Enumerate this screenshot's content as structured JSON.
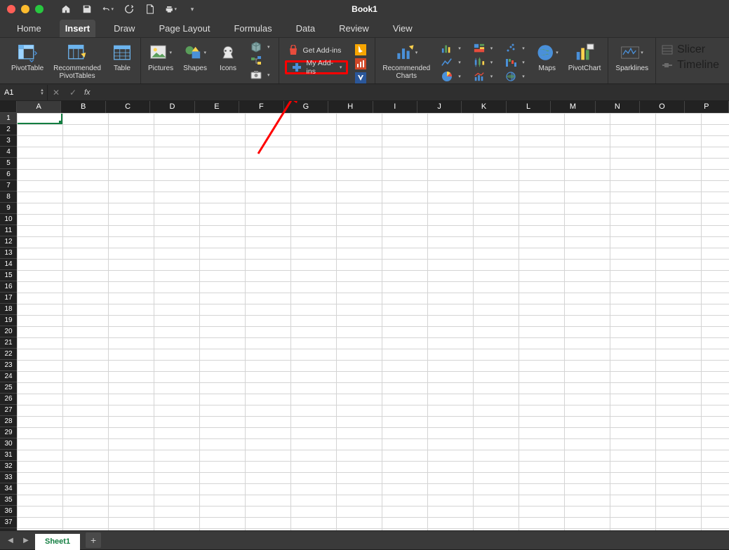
{
  "title": "Book1",
  "tabs": [
    "Home",
    "Insert",
    "Draw",
    "Page Layout",
    "Formulas",
    "Data",
    "Review",
    "View"
  ],
  "active_tab": "Insert",
  "ribbon": {
    "pivottable": "PivotTable",
    "recommended_pivot": "Recommended\nPivotTables",
    "table": "Table",
    "pictures": "Pictures",
    "shapes": "Shapes",
    "icons": "Icons",
    "get_addins": "Get Add-ins",
    "my_addins": "My Add-ins",
    "recommended_charts": "Recommended\nCharts",
    "maps": "Maps",
    "pivotchart": "PivotChart",
    "sparklines": "Sparklines",
    "slicer": "Slicer",
    "timeline": "Timeline"
  },
  "namebox": "A1",
  "columns": [
    "A",
    "B",
    "C",
    "D",
    "E",
    "F",
    "G",
    "H",
    "I",
    "J",
    "K",
    "L",
    "M",
    "N",
    "O",
    "P"
  ],
  "row_count": 37,
  "selected_cell": {
    "col": 0,
    "row": 0
  },
  "sheet": "Sheet1"
}
